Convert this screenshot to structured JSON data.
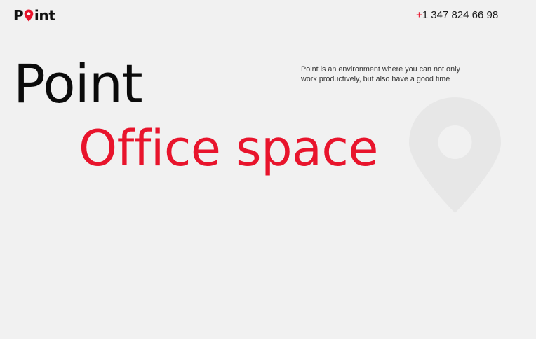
{
  "header": {
    "logo_text_start": "P",
    "logo_text_end": "int",
    "logo_icon": "map-pin-icon",
    "phone_plus": "+",
    "phone_number": "1 347 824 66 98"
  },
  "hero": {
    "title": "Point",
    "subtitle": "Office space",
    "description": "Point is an environment where you can not only work productively, but also have a good time",
    "background_icon": "map-pin-icon"
  },
  "colors": {
    "accent": "#e8142c",
    "text": "#111111",
    "background": "#f1f1f1",
    "decor_pin": "#e7e7e7"
  }
}
